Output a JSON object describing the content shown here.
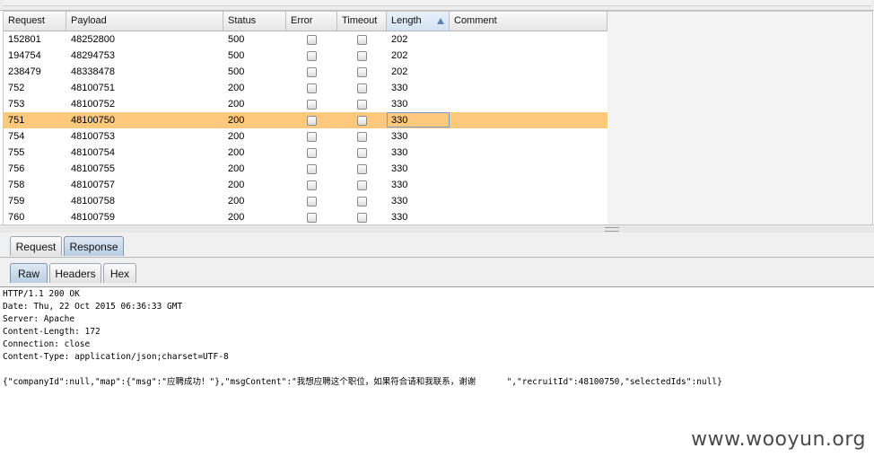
{
  "table": {
    "columns": [
      "Request",
      "Payload",
      "Status",
      "Error",
      "Timeout",
      "Length",
      "Comment"
    ],
    "sort_column": "Length",
    "selected_row_index": 5,
    "rows": [
      {
        "request": "152801",
        "payload": "48252800",
        "status": "500",
        "error": false,
        "timeout": false,
        "length": "202",
        "comment": ""
      },
      {
        "request": "194754",
        "payload": "48294753",
        "status": "500",
        "error": false,
        "timeout": false,
        "length": "202",
        "comment": ""
      },
      {
        "request": "238479",
        "payload": "48338478",
        "status": "500",
        "error": false,
        "timeout": false,
        "length": "202",
        "comment": ""
      },
      {
        "request": "752",
        "payload": "48100751",
        "status": "200",
        "error": false,
        "timeout": false,
        "length": "330",
        "comment": ""
      },
      {
        "request": "753",
        "payload": "48100752",
        "status": "200",
        "error": false,
        "timeout": false,
        "length": "330",
        "comment": ""
      },
      {
        "request": "751",
        "payload": "48100750",
        "status": "200",
        "error": false,
        "timeout": false,
        "length": "330",
        "comment": ""
      },
      {
        "request": "754",
        "payload": "48100753",
        "status": "200",
        "error": false,
        "timeout": false,
        "length": "330",
        "comment": ""
      },
      {
        "request": "755",
        "payload": "48100754",
        "status": "200",
        "error": false,
        "timeout": false,
        "length": "330",
        "comment": ""
      },
      {
        "request": "756",
        "payload": "48100755",
        "status": "200",
        "error": false,
        "timeout": false,
        "length": "330",
        "comment": ""
      },
      {
        "request": "758",
        "payload": "48100757",
        "status": "200",
        "error": false,
        "timeout": false,
        "length": "330",
        "comment": ""
      },
      {
        "request": "759",
        "payload": "48100758",
        "status": "200",
        "error": false,
        "timeout": false,
        "length": "330",
        "comment": ""
      },
      {
        "request": "760",
        "payload": "48100759",
        "status": "200",
        "error": false,
        "timeout": false,
        "length": "330",
        "comment": ""
      }
    ]
  },
  "tabs_main": [
    {
      "label": "Request",
      "active": false
    },
    {
      "label": "Response",
      "active": true
    }
  ],
  "tabs_view": [
    {
      "label": "Raw",
      "active": true
    },
    {
      "label": "Headers",
      "active": false
    },
    {
      "label": "Hex",
      "active": false
    }
  ],
  "response": {
    "lines": [
      "HTTP/1.1 200 OK",
      "Date: Thu, 22 Oct 2015 06:36:33 GMT",
      "Server: Apache",
      "Content-Length: 172",
      "Connection: close",
      "Content-Type: application/json;charset=UTF-8",
      "",
      "{\"companyId\":null,\"map\":{\"msg\":\"应聘成功！\"},\"msgContent\":\"我想应聘这个职位，如果符合请和我联系，谢谢      \",\"recruitId\":48100750,\"selectedIds\":null}"
    ]
  },
  "watermark": "www.wooyun.org",
  "colors": {
    "selected_row": "#ffc97d",
    "active_tab": "#b9cde2"
  }
}
